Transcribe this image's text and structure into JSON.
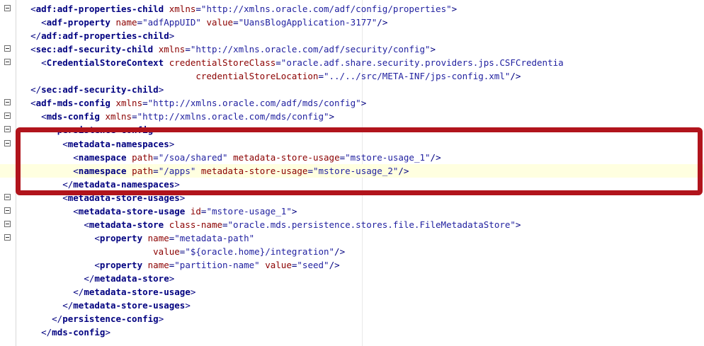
{
  "editor": {
    "lines": [
      {
        "fold": true,
        "current": false,
        "indent": 1,
        "tokens": [
          {
            "k": "p",
            "t": "<"
          },
          {
            "k": "t",
            "t": "adf:adf-properties-child"
          },
          {
            "k": "p",
            "t": " "
          },
          {
            "k": "a",
            "t": "xmlns"
          },
          {
            "k": "p",
            "t": "="
          },
          {
            "k": "v",
            "t": "\"http://xmlns.oracle.com/adf/config/properties\""
          },
          {
            "k": "p",
            "t": ">"
          }
        ]
      },
      {
        "fold": false,
        "current": false,
        "indent": 2,
        "tokens": [
          {
            "k": "p",
            "t": "<"
          },
          {
            "k": "t",
            "t": "adf-property"
          },
          {
            "k": "p",
            "t": " "
          },
          {
            "k": "a",
            "t": "name"
          },
          {
            "k": "p",
            "t": "="
          },
          {
            "k": "v",
            "t": "\"adfAppUID\""
          },
          {
            "k": "p",
            "t": " "
          },
          {
            "k": "a",
            "t": "value"
          },
          {
            "k": "p",
            "t": "="
          },
          {
            "k": "v",
            "t": "\"UansBlogApplication-3177\""
          },
          {
            "k": "p",
            "t": "/>"
          }
        ]
      },
      {
        "fold": false,
        "current": false,
        "indent": 1,
        "tokens": [
          {
            "k": "p",
            "t": "</"
          },
          {
            "k": "t",
            "t": "adf:adf-properties-child"
          },
          {
            "k": "p",
            "t": ">"
          }
        ]
      },
      {
        "fold": true,
        "current": false,
        "indent": 1,
        "tokens": [
          {
            "k": "p",
            "t": "<"
          },
          {
            "k": "t",
            "t": "sec:adf-security-child"
          },
          {
            "k": "p",
            "t": " "
          },
          {
            "k": "a",
            "t": "xmlns"
          },
          {
            "k": "p",
            "t": "="
          },
          {
            "k": "v",
            "t": "\"http://xmlns.oracle.com/adf/security/config\""
          },
          {
            "k": "p",
            "t": ">"
          }
        ]
      },
      {
        "fold": true,
        "current": false,
        "indent": 2,
        "tokens": [
          {
            "k": "p",
            "t": "<"
          },
          {
            "k": "t",
            "t": "CredentialStoreContext"
          },
          {
            "k": "p",
            "t": " "
          },
          {
            "k": "a",
            "t": "credentialStoreClass"
          },
          {
            "k": "p",
            "t": "="
          },
          {
            "k": "v",
            "t": "\"oracle.adf.share.security.providers.jps.CSFCredentia"
          }
        ]
      },
      {
        "fold": false,
        "current": false,
        "indent": 0,
        "pad": "                                 ",
        "tokens": [
          {
            "k": "a",
            "t": "credentialStoreLocation"
          },
          {
            "k": "p",
            "t": "="
          },
          {
            "k": "v",
            "t": "\"../../src/META-INF/jps-config.xml\""
          },
          {
            "k": "p",
            "t": "/>"
          }
        ]
      },
      {
        "fold": false,
        "current": false,
        "indent": 1,
        "tokens": [
          {
            "k": "p",
            "t": "</"
          },
          {
            "k": "t",
            "t": "sec:adf-security-child"
          },
          {
            "k": "p",
            "t": ">"
          }
        ]
      },
      {
        "fold": true,
        "current": false,
        "indent": 1,
        "tokens": [
          {
            "k": "p",
            "t": "<"
          },
          {
            "k": "t",
            "t": "adf-mds-config"
          },
          {
            "k": "p",
            "t": " "
          },
          {
            "k": "a",
            "t": "xmlns"
          },
          {
            "k": "p",
            "t": "="
          },
          {
            "k": "v",
            "t": "\"http://xmlns.oracle.com/adf/mds/config\""
          },
          {
            "k": "p",
            "t": ">"
          }
        ]
      },
      {
        "fold": true,
        "current": false,
        "indent": 2,
        "tokens": [
          {
            "k": "p",
            "t": "<"
          },
          {
            "k": "t",
            "t": "mds-config"
          },
          {
            "k": "p",
            "t": " "
          },
          {
            "k": "a",
            "t": "xmlns"
          },
          {
            "k": "p",
            "t": "="
          },
          {
            "k": "v",
            "t": "\"http://xmlns.oracle.com/mds/config\""
          },
          {
            "k": "p",
            "t": ">"
          }
        ]
      },
      {
        "fold": true,
        "current": false,
        "indent": 3,
        "tokens": [
          {
            "k": "p",
            "t": "<"
          },
          {
            "k": "t",
            "t": "persistence-config"
          },
          {
            "k": "p",
            "t": ">"
          }
        ]
      },
      {
        "fold": true,
        "current": false,
        "indent": 4,
        "tokens": [
          {
            "k": "p",
            "t": "<"
          },
          {
            "k": "t",
            "t": "metadata-namespaces"
          },
          {
            "k": "p",
            "t": ">"
          }
        ]
      },
      {
        "fold": false,
        "current": false,
        "indent": 5,
        "tokens": [
          {
            "k": "p",
            "t": "<"
          },
          {
            "k": "t",
            "t": "namespace"
          },
          {
            "k": "p",
            "t": " "
          },
          {
            "k": "a",
            "t": "path"
          },
          {
            "k": "p",
            "t": "="
          },
          {
            "k": "v",
            "t": "\"/soa/shared\""
          },
          {
            "k": "p",
            "t": " "
          },
          {
            "k": "a",
            "t": "metadata-store-usage"
          },
          {
            "k": "p",
            "t": "="
          },
          {
            "k": "v",
            "t": "\"mstore-usage_1\""
          },
          {
            "k": "p",
            "t": "/>"
          }
        ]
      },
      {
        "fold": false,
        "current": true,
        "indent": 5,
        "tokens": [
          {
            "k": "p",
            "t": "<"
          },
          {
            "k": "t",
            "t": "namespace"
          },
          {
            "k": "p",
            "t": " "
          },
          {
            "k": "a",
            "t": "path"
          },
          {
            "k": "p",
            "t": "="
          },
          {
            "k": "v",
            "t": "\"/apps\""
          },
          {
            "k": "p",
            "t": " "
          },
          {
            "k": "a",
            "t": "metadata-store-usage"
          },
          {
            "k": "p",
            "t": "="
          },
          {
            "k": "v",
            "t": "\"mstore-usage_2\""
          },
          {
            "k": "p",
            "t": "/>"
          }
        ]
      },
      {
        "fold": false,
        "current": false,
        "indent": 4,
        "tokens": [
          {
            "k": "p",
            "t": "</"
          },
          {
            "k": "t",
            "t": "metadata-namespaces"
          },
          {
            "k": "p",
            "t": ">"
          }
        ]
      },
      {
        "fold": true,
        "current": false,
        "indent": 4,
        "tokens": [
          {
            "k": "p",
            "t": "<"
          },
          {
            "k": "t",
            "t": "metadata-store-usages"
          },
          {
            "k": "p",
            "t": ">"
          }
        ]
      },
      {
        "fold": true,
        "current": false,
        "indent": 5,
        "tokens": [
          {
            "k": "p",
            "t": "<"
          },
          {
            "k": "t",
            "t": "metadata-store-usage"
          },
          {
            "k": "p",
            "t": " "
          },
          {
            "k": "a",
            "t": "id"
          },
          {
            "k": "p",
            "t": "="
          },
          {
            "k": "v",
            "t": "\"mstore-usage_1\""
          },
          {
            "k": "p",
            "t": ">"
          }
        ]
      },
      {
        "fold": true,
        "current": false,
        "indent": 6,
        "tokens": [
          {
            "k": "p",
            "t": "<"
          },
          {
            "k": "t",
            "t": "metadata-store"
          },
          {
            "k": "p",
            "t": " "
          },
          {
            "k": "a",
            "t": "class-name"
          },
          {
            "k": "p",
            "t": "="
          },
          {
            "k": "v",
            "t": "\"oracle.mds.persistence.stores.file.FileMetadataStore\""
          },
          {
            "k": "p",
            "t": ">"
          }
        ]
      },
      {
        "fold": true,
        "current": false,
        "indent": 7,
        "tokens": [
          {
            "k": "p",
            "t": "<"
          },
          {
            "k": "t",
            "t": "property"
          },
          {
            "k": "p",
            "t": " "
          },
          {
            "k": "a",
            "t": "name"
          },
          {
            "k": "p",
            "t": "="
          },
          {
            "k": "v",
            "t": "\"metadata-path\""
          }
        ]
      },
      {
        "fold": false,
        "current": false,
        "indent": 0,
        "pad": "                         ",
        "tokens": [
          {
            "k": "a",
            "t": "value"
          },
          {
            "k": "p",
            "t": "="
          },
          {
            "k": "v",
            "t": "\"${oracle.home}/integration\""
          },
          {
            "k": "p",
            "t": "/>"
          }
        ]
      },
      {
        "fold": false,
        "current": false,
        "indent": 7,
        "tokens": [
          {
            "k": "p",
            "t": "<"
          },
          {
            "k": "t",
            "t": "property"
          },
          {
            "k": "p",
            "t": " "
          },
          {
            "k": "a",
            "t": "name"
          },
          {
            "k": "p",
            "t": "="
          },
          {
            "k": "v",
            "t": "\"partition-name\""
          },
          {
            "k": "p",
            "t": " "
          },
          {
            "k": "a",
            "t": "value"
          },
          {
            "k": "p",
            "t": "="
          },
          {
            "k": "v",
            "t": "\"seed\""
          },
          {
            "k": "p",
            "t": "/>"
          }
        ]
      },
      {
        "fold": false,
        "current": false,
        "indent": 6,
        "tokens": [
          {
            "k": "p",
            "t": "</"
          },
          {
            "k": "t",
            "t": "metadata-store"
          },
          {
            "k": "p",
            "t": ">"
          }
        ]
      },
      {
        "fold": false,
        "current": false,
        "indent": 5,
        "tokens": [
          {
            "k": "p",
            "t": "</"
          },
          {
            "k": "t",
            "t": "metadata-store-usage"
          },
          {
            "k": "p",
            "t": ">"
          }
        ]
      },
      {
        "fold": false,
        "current": false,
        "indent": 4,
        "tokens": [
          {
            "k": "p",
            "t": "</"
          },
          {
            "k": "t",
            "t": "metadata-store-usages"
          },
          {
            "k": "p",
            "t": ">"
          }
        ]
      },
      {
        "fold": false,
        "current": false,
        "indent": 3,
        "tokens": [
          {
            "k": "p",
            "t": "</"
          },
          {
            "k": "t",
            "t": "persistence-config"
          },
          {
            "k": "p",
            "t": ">"
          }
        ]
      },
      {
        "fold": false,
        "current": false,
        "indent": 2,
        "tokens": [
          {
            "k": "p",
            "t": "</"
          },
          {
            "k": "t",
            "t": "mds-config"
          },
          {
            "k": "p",
            "t": ">"
          }
        ]
      }
    ],
    "annotation_color": "#b1141c",
    "current_line_color": "#ffffe0"
  }
}
